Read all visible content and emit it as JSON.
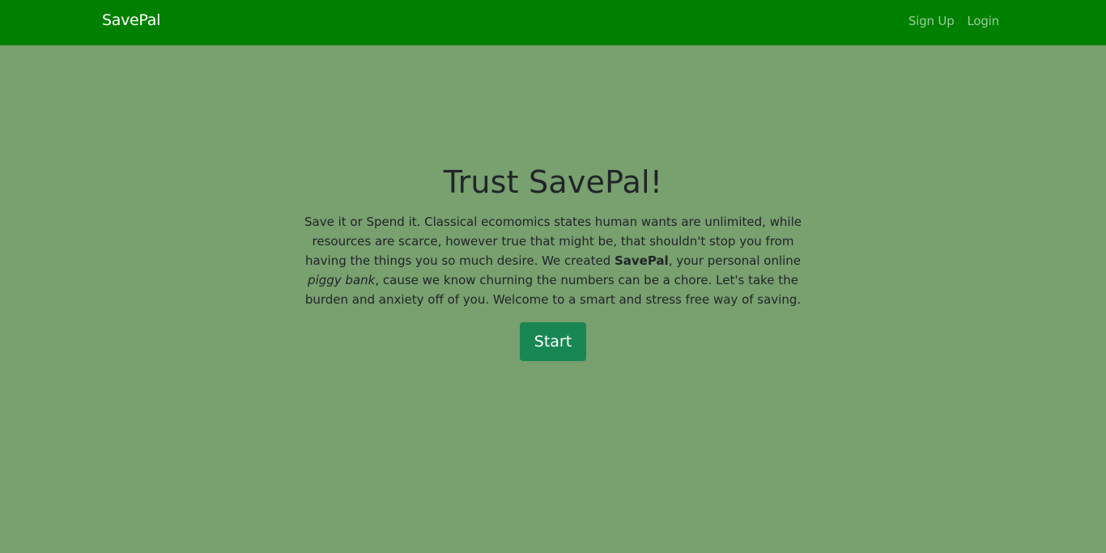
{
  "navbar": {
    "brand": "SavePal",
    "links": [
      {
        "label": "Sign Up"
      },
      {
        "label": "Login"
      }
    ]
  },
  "hero": {
    "title": "Trust SavePal!",
    "paragraph": {
      "part1": "Save it or Spend it. Classical ecomomics states human wants are unlimited, while resources are scarce, however true that might be, that shouldn't stop you from having the things you so much desire. We created ",
      "bold": "SavePal",
      "part2": ", your personal online ",
      "italic": "piggy bank",
      "part3": ", cause we know churning the numbers can be a chore. Let's take the burden and anxiety off of you. Welcome to a smart and stress free way of saving."
    },
    "button_label": "Start"
  },
  "colors": {
    "navbar_bg": "#008000",
    "page_bg": "#79a06f",
    "button_bg": "#198754",
    "text": "#212529"
  }
}
